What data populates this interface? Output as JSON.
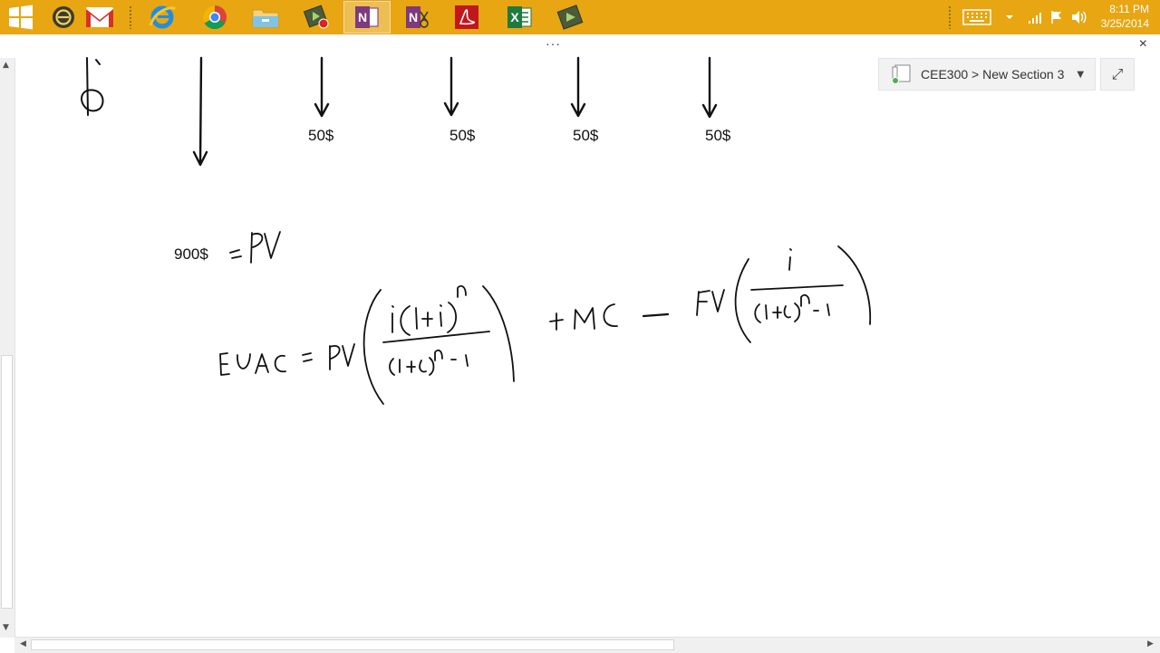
{
  "taskbar": {
    "clock_time": "8:11 PM",
    "clock_date": "3/25/2014",
    "pinned": [
      {
        "name": "start-button",
        "icon": "windows-logo-icon"
      },
      {
        "name": "taskbar-app-1",
        "icon": "circle-app-icon"
      },
      {
        "name": "taskbar-gmail",
        "icon": "gmail-icon"
      },
      {
        "name": "taskbar-ie",
        "icon": "internet-explorer-icon"
      },
      {
        "name": "taskbar-chrome",
        "icon": "chrome-icon"
      },
      {
        "name": "taskbar-file-explorer",
        "icon": "folder-icon"
      },
      {
        "name": "taskbar-camtasia-recorder",
        "icon": "camtasia-recorder-icon"
      },
      {
        "name": "taskbar-onenote",
        "icon": "onenote-icon"
      },
      {
        "name": "taskbar-onenote-clip",
        "icon": "onenote-clip-icon"
      },
      {
        "name": "taskbar-acrobat",
        "icon": "acrobat-icon"
      },
      {
        "name": "taskbar-excel",
        "icon": "excel-icon"
      },
      {
        "name": "taskbar-camtasia",
        "icon": "camtasia-icon"
      }
    ],
    "tray_icons": [
      "touch-keyboard-icon",
      "show-hidden-icons-icon",
      "network-icon",
      "action-center-flag-icon",
      "volume-icon"
    ]
  },
  "onenote": {
    "more_dots": "···",
    "close_glyph": "×",
    "notebook_location": "CEE300 > New Section 3",
    "section_caret": "▼",
    "expand_glyph": "⤢"
  },
  "note": {
    "typed_labels": {
      "payment_1": "50$",
      "payment_2": "50$",
      "payment_3": "50$",
      "payment_4": "50$",
      "initial_cost": "900$"
    }
  },
  "colors": {
    "taskbar_bg": "#e7a612",
    "ink": "#111111",
    "canvas_bg": "#ffffff"
  }
}
